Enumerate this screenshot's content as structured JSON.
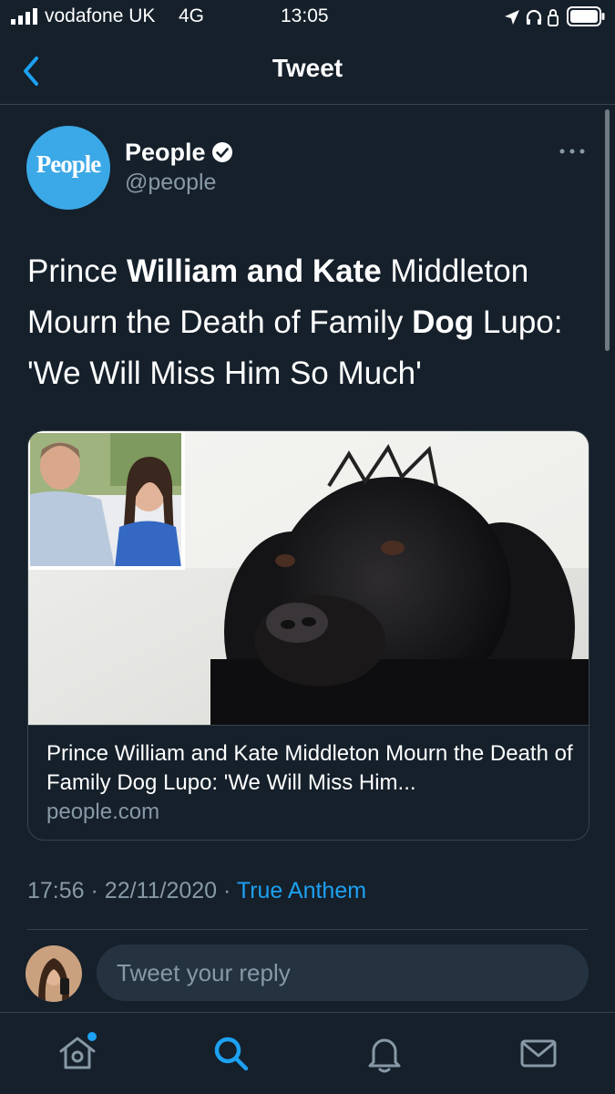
{
  "status_bar": {
    "carrier": "vodafone UK",
    "network": "4G",
    "time": "13:05",
    "icons": [
      "signal-icon",
      "location-icon",
      "headphones-icon",
      "rotation-lock-icon",
      "battery-icon"
    ]
  },
  "nav": {
    "title": "Tweet",
    "back_icon": "chevron-left-icon"
  },
  "tweet": {
    "author": {
      "name": "People",
      "handle": "@people",
      "avatar_text": "People",
      "verified": true
    },
    "text_segments": [
      {
        "text": "Prince ",
        "bold": false
      },
      {
        "text": "William and Kate",
        "bold": true
      },
      {
        "text": " Middleton Mourn the Death of Family ",
        "bold": false
      },
      {
        "text": "Dog",
        "bold": true
      },
      {
        "text": " Lupo: 'We Will Miss Him So Much'",
        "bold": false
      }
    ],
    "card": {
      "title": "Prince William and Kate Middleton Mourn the Death of Family Dog Lupo: 'We Will Miss Him...",
      "domain": "people.com"
    },
    "meta": {
      "time": "17:56",
      "date": "22/11/2020",
      "separator": "·",
      "app": "True Anthem"
    }
  },
  "reply": {
    "placeholder": "Tweet your reply"
  },
  "tabs": [
    {
      "name": "home",
      "icon": "home-icon",
      "has_badge": true
    },
    {
      "name": "search",
      "icon": "search-icon",
      "active": true
    },
    {
      "name": "notifications",
      "icon": "bell-icon"
    },
    {
      "name": "messages",
      "icon": "mail-icon"
    }
  ],
  "colors": {
    "background": "#15202b",
    "accent": "#1da1f2",
    "secondary_text": "#8899a6",
    "border": "#38444d",
    "avatar_bg": "#3ba8e7"
  }
}
